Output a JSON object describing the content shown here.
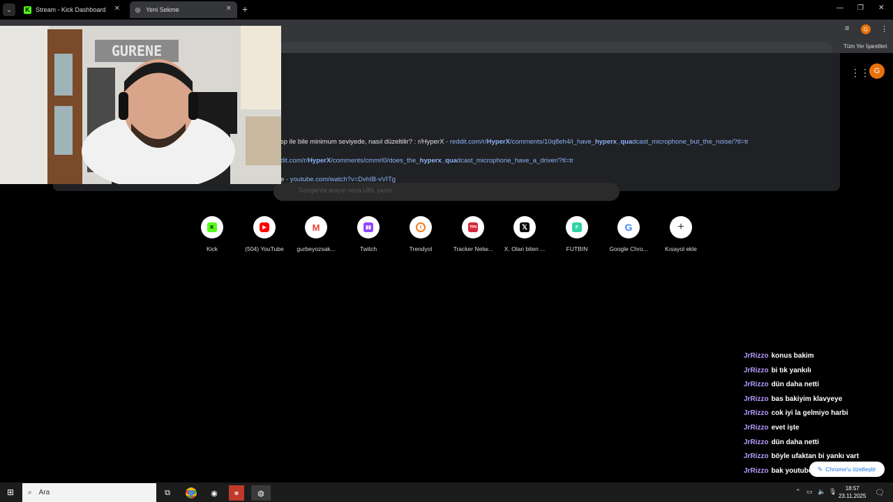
{
  "browser": {
    "tabs": [
      {
        "title": "Stream - Kick Dashboard",
        "favicon": "kick-icon"
      },
      {
        "title": "Yeni Sekme",
        "favicon": "chrome-newtab-icon"
      }
    ],
    "profile_initial": "G",
    "bookmarks_label": "Tüm Yer İşaretleri"
  },
  "suggestions": [
    {
      "text": "sp ile bile minimum seviyede, nasıl düzeltilir? : r/HyperX",
      "sep": " - ",
      "url_pre": "reddit.com/r/",
      "url_bold1": "HyperX",
      "url_mid": "/comments/10q8eh4/i_have_",
      "url_bold2": "hyperx_qua",
      "url_post": "dcast_microphone_but_the_noise/?tl=tr"
    },
    {
      "text": "",
      "sep": "",
      "url_pre": "dit.com/r/",
      "url_bold1": "HyperX",
      "url_mid": "/comments/cmmrl0/does_the_",
      "url_bold2": "hyperx_qua",
      "url_post": "dcast_microphone_have_a_driver/?tl=tr"
    },
    {
      "text": "e",
      "sep": " - ",
      "url_pre": "youtube.com/watch?v=DvhIB-vVITg",
      "url_bold1": "",
      "url_mid": "",
      "url_bold2": "",
      "url_post": ""
    }
  ],
  "ntp": {
    "search_placeholder": "Google'da arayın veya URL yazın",
    "profile_initial": "G",
    "shortcuts": [
      {
        "label": "Kick",
        "icon": "kick-icon",
        "color": "#53fc18"
      },
      {
        "label": "(504) YouTube",
        "icon": "youtube-icon",
        "color": "#ff0000"
      },
      {
        "label": "gurbeyozsak...",
        "icon": "gmail-icon",
        "color": "#ea4335"
      },
      {
        "label": "Twitch",
        "icon": "twitch-icon",
        "color": "#9146ff"
      },
      {
        "label": "Trendyol",
        "icon": "trendyol-icon",
        "color": "#f27a1a"
      },
      {
        "label": "Tracker Netw...",
        "icon": "tracker-network-icon",
        "color": "#d7263d"
      },
      {
        "label": "X. Olan biten ...",
        "icon": "x-icon",
        "color": "#000000"
      },
      {
        "label": "FUTBIN",
        "icon": "futbin-icon",
        "color": "#2ed3a6"
      },
      {
        "label": "Google Chro...",
        "icon": "google-icon",
        "color": "#4285f4"
      },
      {
        "label": "Kısayol ekle",
        "icon": "plus-icon",
        "color": "#333333"
      }
    ],
    "customize_label": "Chrome'u özelleştir"
  },
  "chat": [
    {
      "user": "JrRizzo",
      "msg": "konus bakim"
    },
    {
      "user": "JrRizzo",
      "msg": "bi tık yankılı"
    },
    {
      "user": "JrRizzo",
      "msg": "dün daha netti"
    },
    {
      "user": "JrRizzo",
      "msg": "bas bakiyim klavyeye"
    },
    {
      "user": "JrRizzo",
      "msg": "cok iyi la gelmiyo harbi"
    },
    {
      "user": "JrRizzo",
      "msg": "evet işte"
    },
    {
      "user": "JrRizzo",
      "msg": "dün daha netti"
    },
    {
      "user": "JrRizzo",
      "msg": "böyle ufaktan bi yankı vart"
    },
    {
      "user": "JrRizzo",
      "msg": "bak youtubeden"
    }
  ],
  "taskbar": {
    "search_label": "Ara",
    "time": "18:57",
    "date": "23.11.2025"
  }
}
